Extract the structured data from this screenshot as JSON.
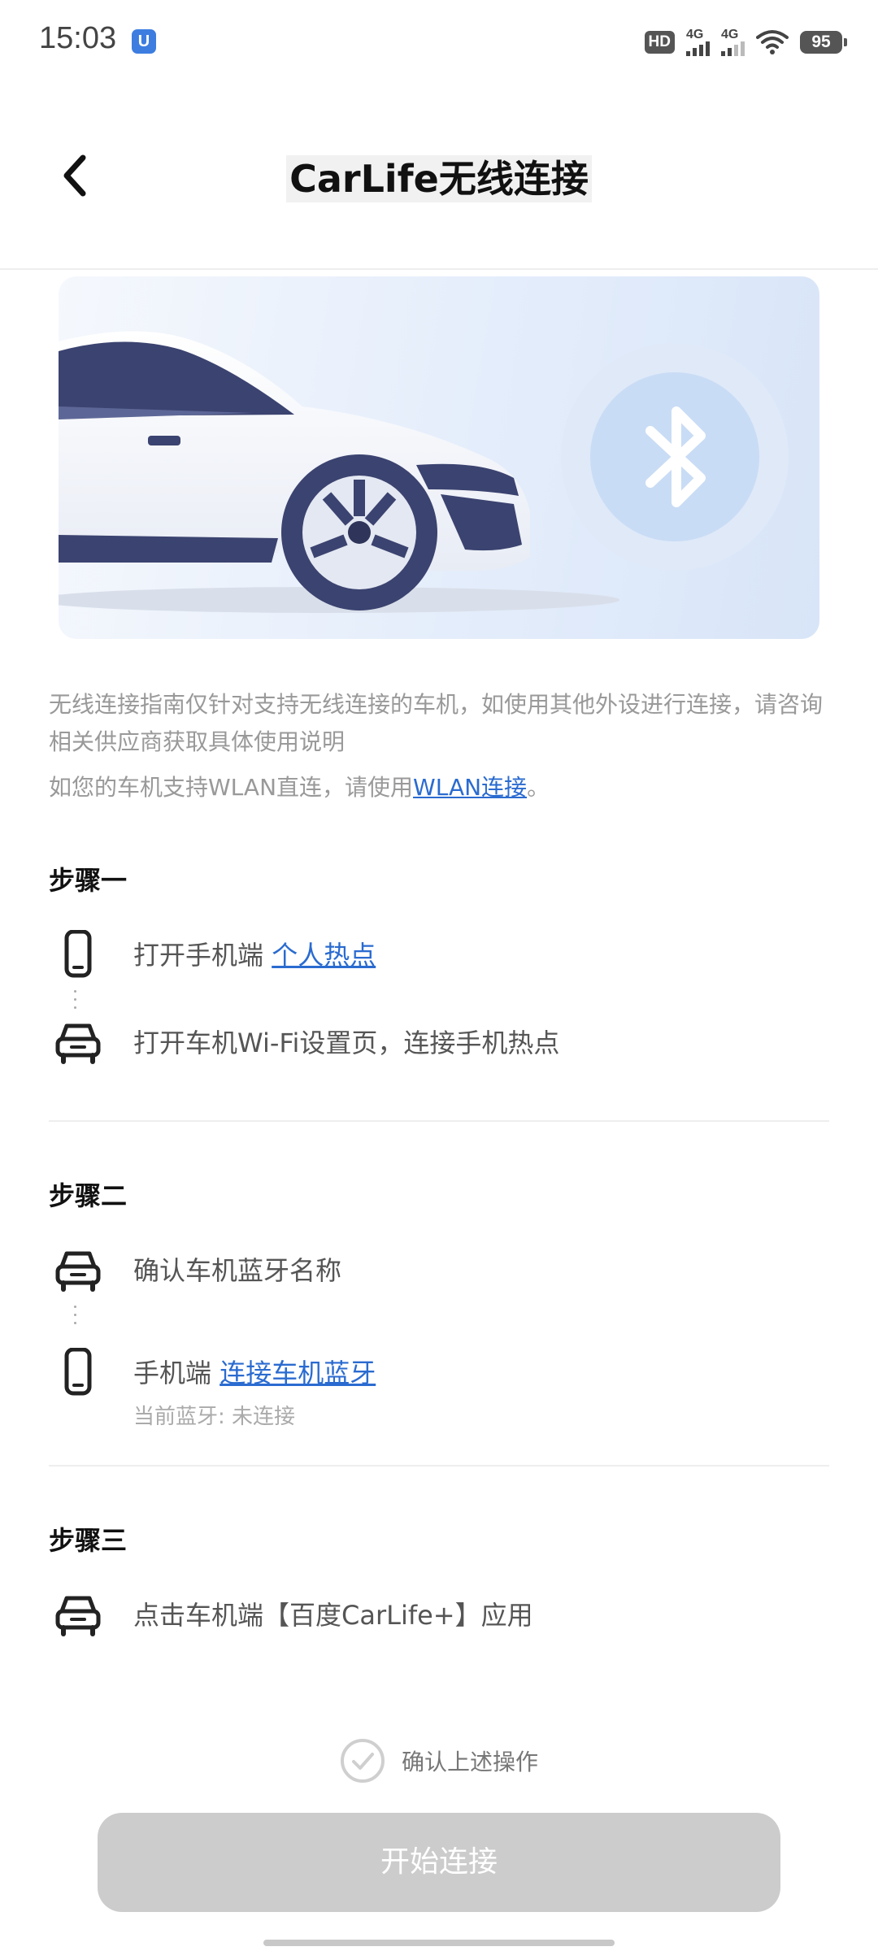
{
  "status_bar": {
    "time": "15:03",
    "app_badge": "U",
    "hd_label": "HD",
    "signal1_label": "4G",
    "signal2_label": "4G",
    "battery": "95"
  },
  "header": {
    "title": "CarLife无线连接"
  },
  "notes": {
    "note1": "无线连接指南仅针对支持无线连接的车机，如使用其他外设进行连接，请咨询相关供应商获取具体使用说明",
    "note2_prefix": "如您的车机支持WLAN直连，请使用",
    "note2_link": "WLAN连接",
    "note2_suffix": "。"
  },
  "steps": [
    {
      "title": "步骤一",
      "items": [
        {
          "icon": "phone-icon",
          "text": "打开手机端 ",
          "link": "个人热点"
        },
        {
          "icon": "car-icon",
          "text": "打开车机Wi-Fi设置页，连接手机热点"
        }
      ]
    },
    {
      "title": "步骤二",
      "items": [
        {
          "icon": "car-icon",
          "text": "确认车机蓝牙名称"
        },
        {
          "icon": "phone-icon",
          "text": "手机端 ",
          "link": "连接车机蓝牙",
          "sub": "当前蓝牙:  未连接"
        }
      ]
    },
    {
      "title": "步骤三",
      "items": [
        {
          "icon": "car-icon",
          "text": "点击车机端【百度CarLife+】应用"
        }
      ]
    }
  ],
  "confirm_label": "确认上述操作",
  "start_button": "开始连接",
  "colors": {
    "link": "#2a6bd0",
    "button_disabled": "#cccccc",
    "bluetooth": "#ffffff",
    "car_dark": "#3b4370"
  }
}
